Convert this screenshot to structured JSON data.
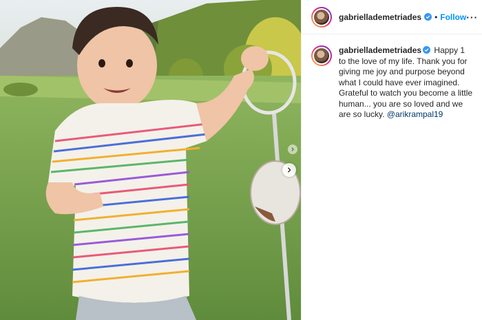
{
  "post": {
    "username": "gabriellademetriades",
    "verified": true,
    "follow_label": "Follow",
    "separator": "•",
    "more_label": "···",
    "caption": {
      "username": "gabriellademetriades",
      "text": "Happy 1 to the love of my life. Thank you for giving me joy and purpose beyond what I could have ever imagined. Grateful to watch you become a little human... you are so loved and we are so lucky.",
      "mention": "@arikrampal19"
    }
  },
  "colors": {
    "follow": "#0095f6",
    "verified": "#3897f0",
    "mention": "#00376b"
  },
  "icons": [
    "verified-badge-icon",
    "chevron-right-icon",
    "chevron-left-icon",
    "more-options-icon"
  ]
}
